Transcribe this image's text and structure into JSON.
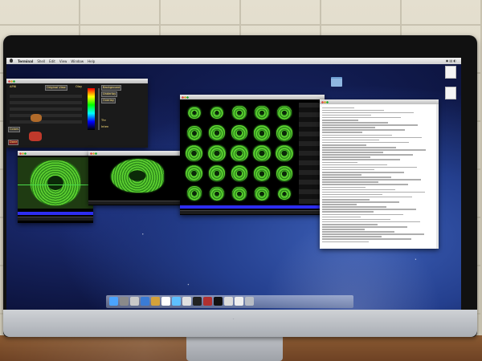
{
  "menubar": {
    "items": [
      "Terminal",
      "Shell",
      "Edit",
      "View",
      "Window",
      "Help"
    ]
  },
  "desktop_icons": [
    {
      "label": "",
      "icon": "folder-icon"
    },
    {
      "label": "",
      "icon": "document-icon"
    },
    {
      "label": "",
      "icon": "document-icon"
    }
  ],
  "control_panel": {
    "buttons": [
      "Original View",
      "Background",
      "Underlay",
      "Overlay",
      "Colors",
      "Done"
    ],
    "labels": [
      "AFNI",
      "Olay",
      "Thr",
      "Inten"
    ]
  },
  "colors": {
    "brain_green": "#5fd431",
    "panel_yellow": "#ffe27a",
    "strip_blue": "#2d2df0"
  },
  "montage": {
    "rows": 5,
    "cols": 5
  },
  "terminal": {
    "title": "",
    "lines": []
  },
  "dock": {
    "icons": [
      "finder-icon",
      "dashboard-icon",
      "mail-icon",
      "safari-icon",
      "photos-icon",
      "calendar-icon",
      "itunes-icon",
      "preview-icon",
      "terminal-icon",
      "app-icon",
      "x11-icon",
      "stack-icon",
      "stack-icon",
      "trash-icon"
    ]
  }
}
